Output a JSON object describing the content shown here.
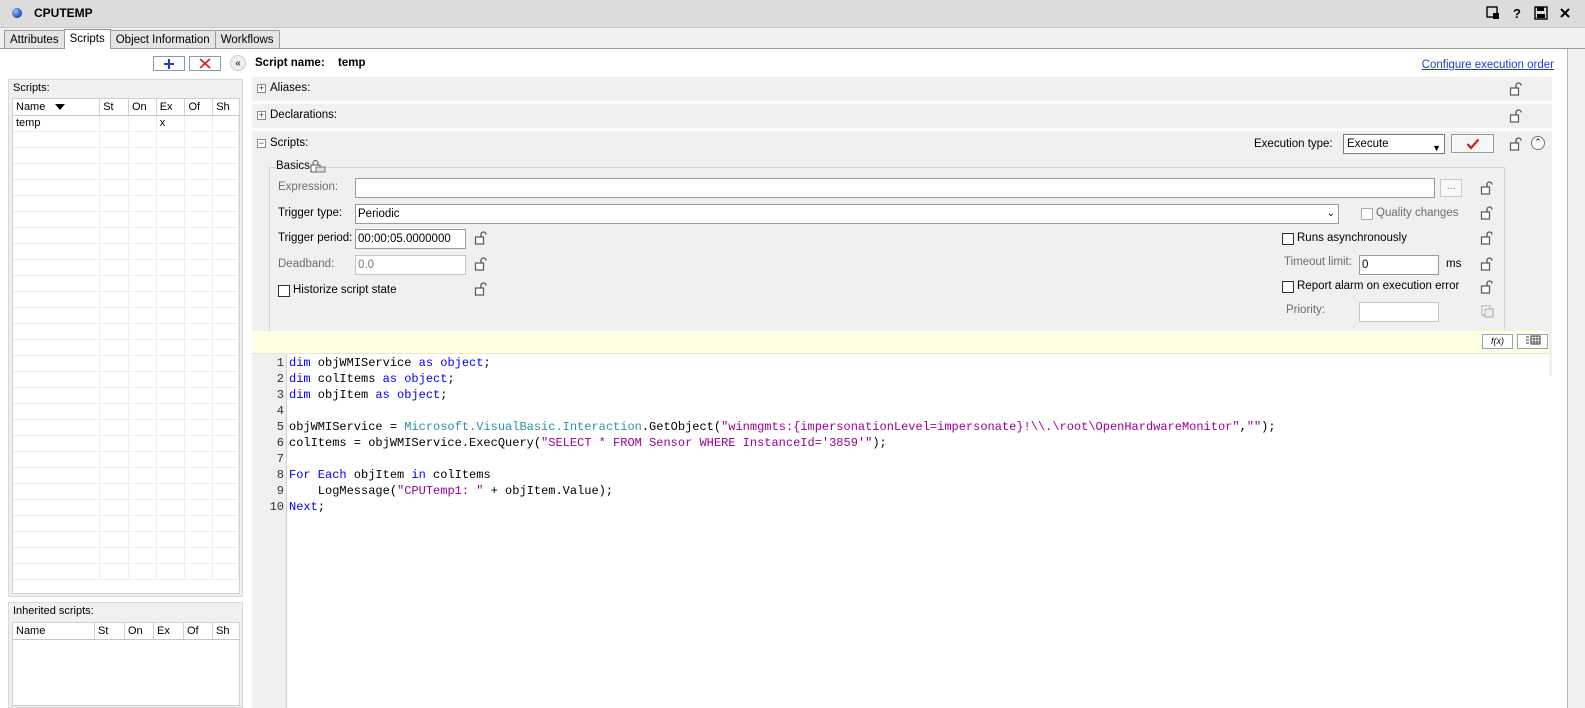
{
  "window": {
    "title": "CPUTEMP",
    "icons": [
      "lock-screen-icon",
      "help-icon",
      "save-icon",
      "close-icon"
    ]
  },
  "tabs": [
    {
      "label": "Attributes",
      "active": false
    },
    {
      "label": "Scripts",
      "active": true
    },
    {
      "label": "Object Information",
      "active": false
    },
    {
      "label": "Workflows",
      "active": false
    }
  ],
  "left": {
    "scripts_label": "Scripts:",
    "columns": [
      "Name",
      "St",
      "On",
      "Ex",
      "Of",
      "Sh"
    ],
    "rows": [
      {
        "name": "temp",
        "st": "",
        "on": "",
        "ex": "x",
        "of": "",
        "sh": ""
      }
    ],
    "inherited_label": "Inherited scripts:",
    "inherited_columns": [
      "Name",
      "St",
      "On",
      "Ex",
      "Of",
      "Sh"
    ]
  },
  "script": {
    "name_label": "Script name:",
    "name_value": "temp",
    "configure_link": "Configure execution order",
    "sections": {
      "aliases": "Aliases:",
      "declarations": "Declarations:",
      "scripts": "Scripts:"
    },
    "execution_type_label": "Execution type:",
    "execution_type_value": "Execute",
    "basics_title": "Basics",
    "expression_label": "Expression:",
    "expression_value": "",
    "ellipsis": "...",
    "trigger_type_label": "Trigger type:",
    "trigger_type_value": "Periodic",
    "quality_changes_label": "Quality changes",
    "trigger_period_label": "Trigger period:",
    "trigger_period_value": "00:00:05.0000000",
    "runs_async_label": "Runs asynchronously",
    "deadband_label": "Deadband:",
    "deadband_value": "0.0",
    "timeout_label": "Timeout limit:",
    "timeout_value": "0",
    "timeout_unit": "ms",
    "historize_label": "Historize script state",
    "report_alarm_label": "Report alarm on execution error",
    "priority_label": "Priority:",
    "priority_value": ""
  },
  "editor": {
    "line_numbers": [
      "1",
      "2",
      "3",
      "4",
      "5",
      "6",
      "7",
      "8",
      "9",
      "10"
    ]
  },
  "colors": {
    "keyword": "#0000ff",
    "string": "#990099",
    "namespace": "#2b91af",
    "link": "#1f3fcf",
    "editor_toolbar": "#ffffe1"
  }
}
